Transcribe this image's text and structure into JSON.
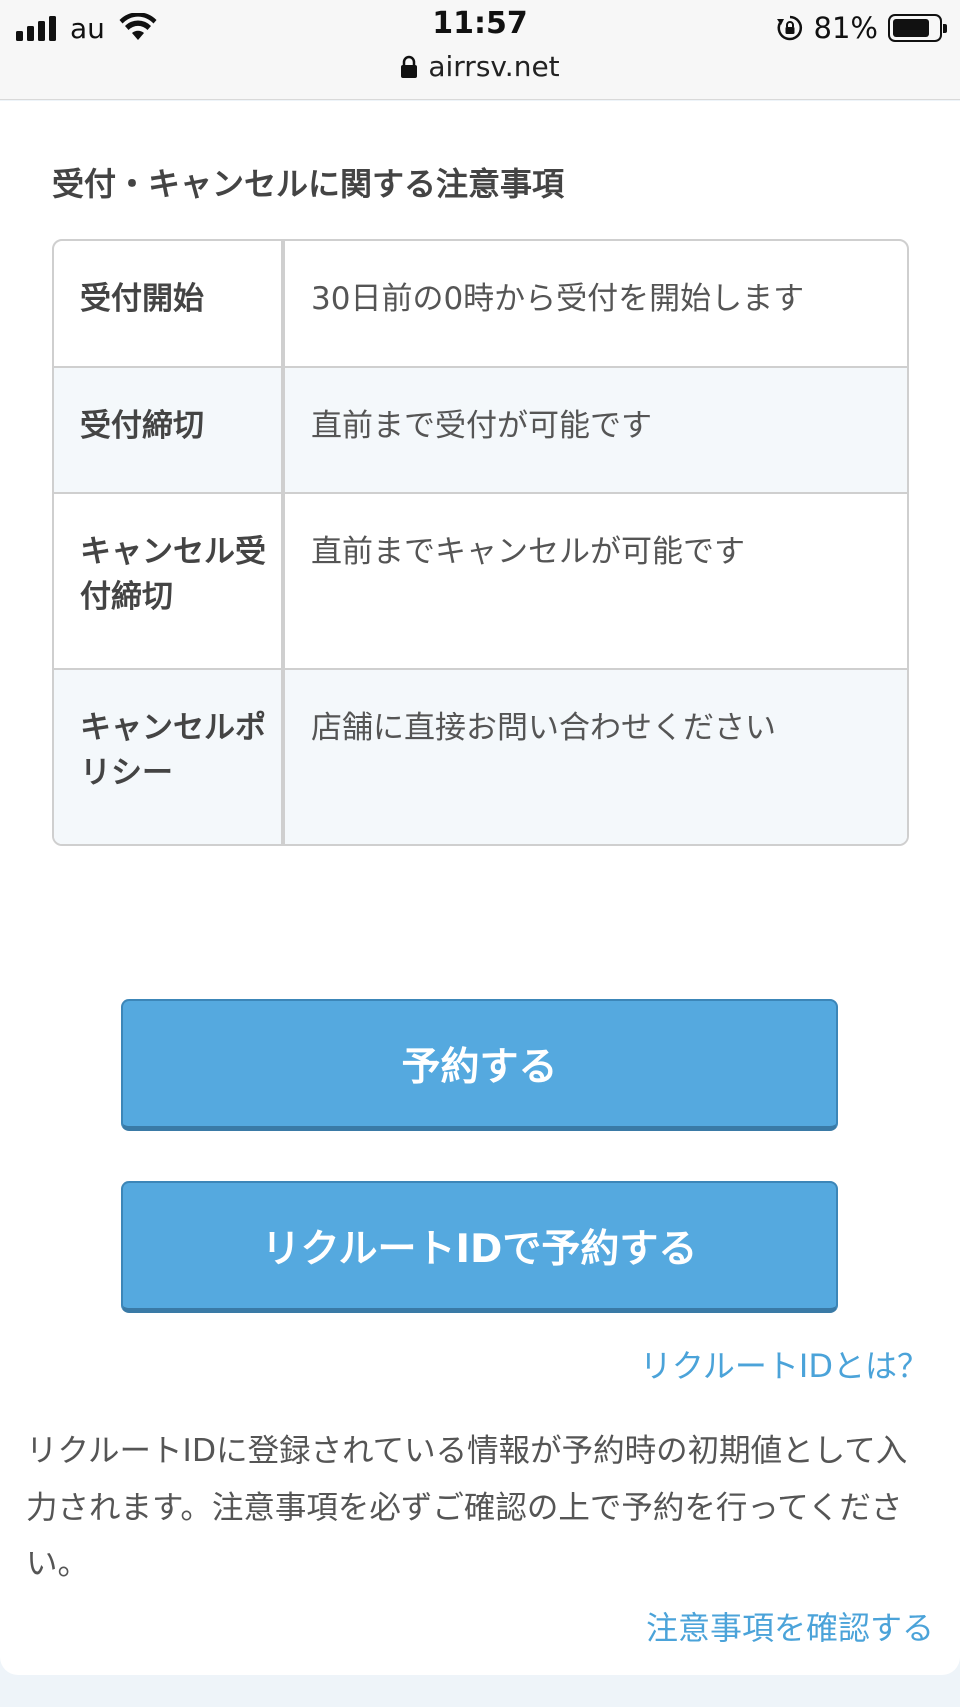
{
  "status_bar": {
    "carrier": "au",
    "time": "11:57",
    "battery_percent": "81%",
    "battery_level": 0.81,
    "url": "airrsv.net",
    "icons": [
      "signal-icon",
      "wifi-icon",
      "rotation-lock-icon",
      "battery-icon",
      "padlock-icon"
    ]
  },
  "notice": {
    "title": "受付・キャンセルに関する注意事項",
    "rows": [
      {
        "label": "受付開始",
        "value": "30日前の0時から受付を開始します"
      },
      {
        "label": "受付締切",
        "value": "直前まで受付が可能です"
      },
      {
        "label": "キャンセル受付締切",
        "value": "直前までキャンセルが可能です"
      },
      {
        "label": "キャンセルポリシー",
        "value": "店舗に直接お問い合わせください"
      }
    ]
  },
  "actions": {
    "reserve_label": "予約する",
    "recruit_reserve_label": "リクルートIDで予約する",
    "what_is_recruit_id": "リクルートIDとは？",
    "description": "リクルートIDに登録されている情報が予約時の初期値として入力されます。注意事項を必ずご確認の上で予約を行ってください。",
    "confirm_notice_link": "注意事項を確認する"
  },
  "colors": {
    "button_bg": "#55a9df",
    "link": "#4ba3d9",
    "alt_row_bg": "#f4f8fb"
  }
}
